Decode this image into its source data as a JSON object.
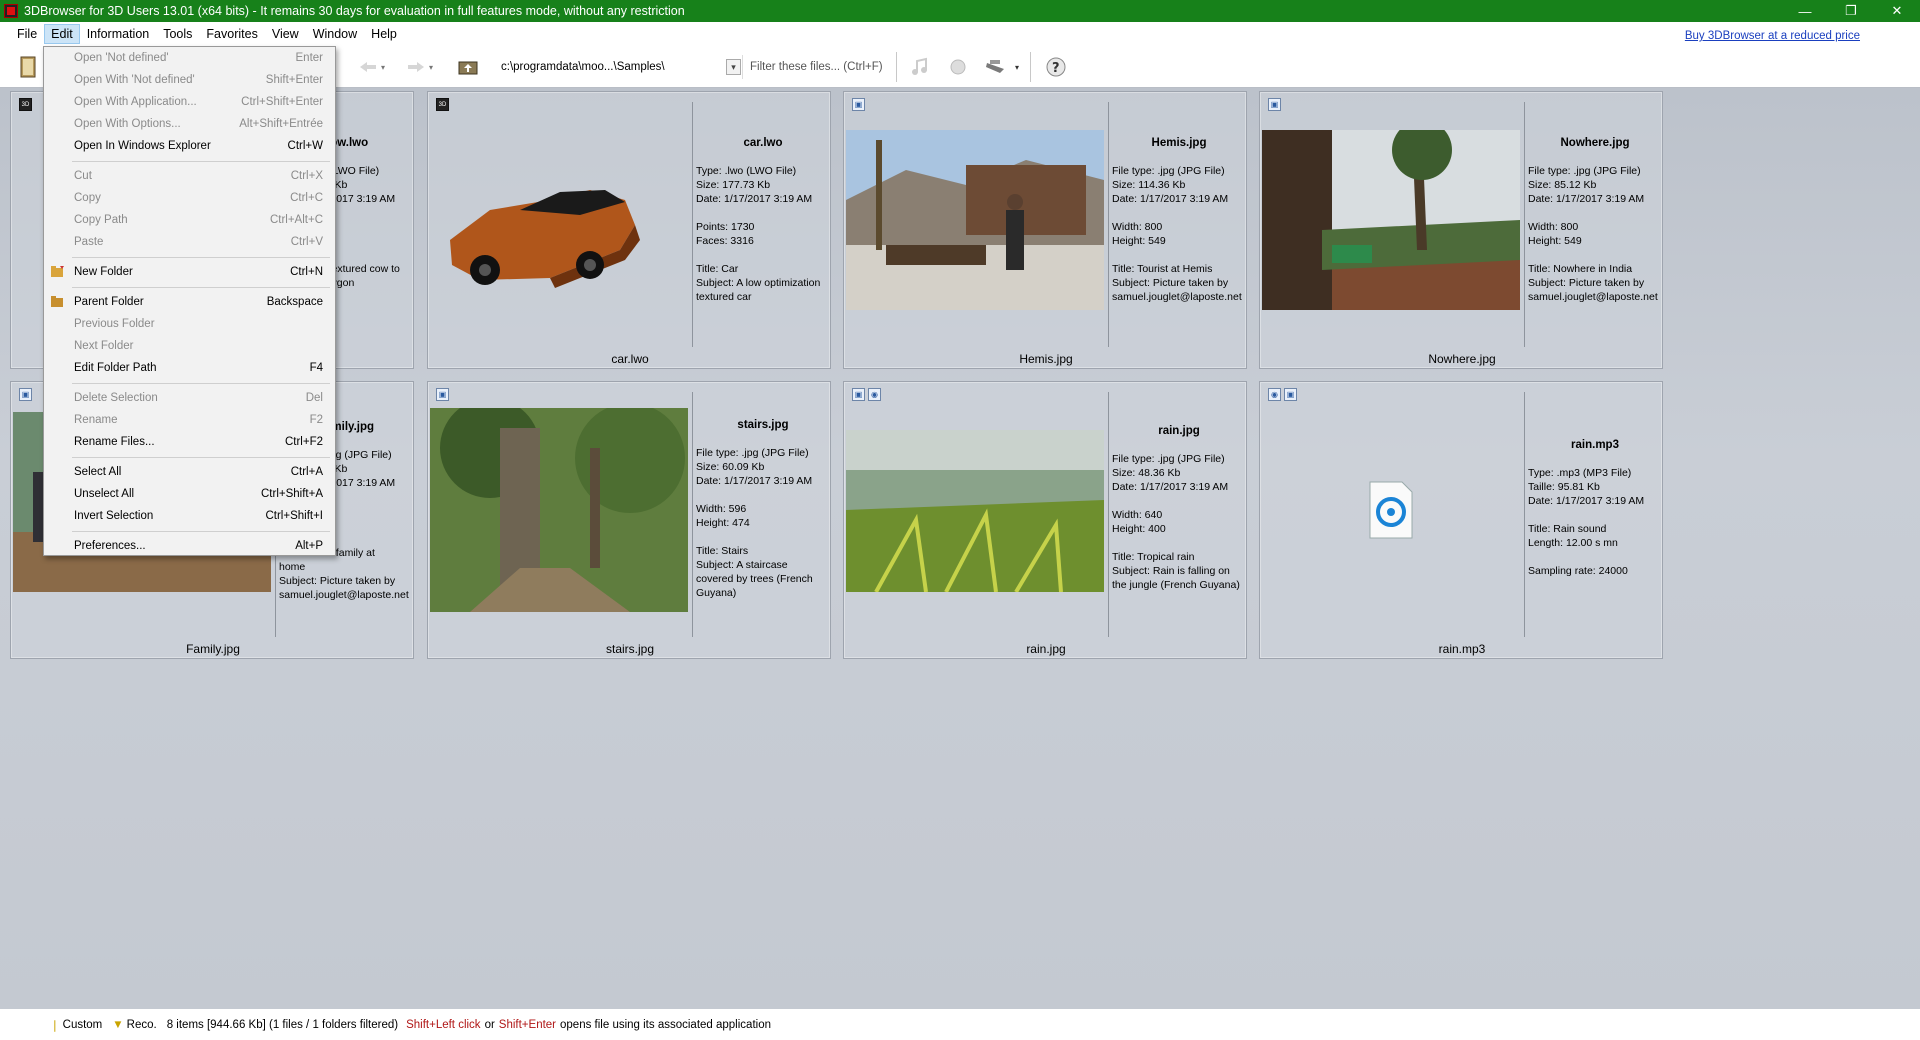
{
  "window": {
    "title": "3DBrowser for 3D Users 13.01 (x64 bits) - It remains 30 days for evaluation in full features mode, without any restriction",
    "buy_link": "Buy 3DBrowser at a reduced price"
  },
  "menubar": [
    "File",
    "Edit",
    "Information",
    "Tools",
    "Favorites",
    "View",
    "Window",
    "Help"
  ],
  "toolbar": {
    "path": "c:\\programdata\\moo...\\Samples\\",
    "filter_placeholder": "Filter these files... (Ctrl+F)"
  },
  "edit_menu": {
    "items": [
      {
        "label": "Open 'Not defined'",
        "shortcut": "Enter"
      },
      {
        "label": "Open With 'Not defined'",
        "shortcut": "Shift+Enter"
      },
      {
        "label": "Open With Application...",
        "shortcut": "Ctrl+Shift+Enter"
      },
      {
        "label": "Open With Options...",
        "shortcut": "Alt+Shift+Entrée"
      },
      {
        "label": "Open In Windows Explorer",
        "shortcut": "Ctrl+W"
      },
      {
        "label": "Cut",
        "shortcut": "Ctrl+X"
      },
      {
        "label": "Copy",
        "shortcut": "Ctrl+C"
      },
      {
        "label": "Copy Path",
        "shortcut": "Ctrl+Alt+C"
      },
      {
        "label": "Paste",
        "shortcut": "Ctrl+V"
      },
      {
        "label": "New Folder",
        "shortcut": "Ctrl+N"
      },
      {
        "label": "Parent Folder",
        "shortcut": "Backspace"
      },
      {
        "label": "Previous Folder",
        "shortcut": ""
      },
      {
        "label": "Next Folder",
        "shortcut": ""
      },
      {
        "label": "Edit Folder Path",
        "shortcut": "F4"
      },
      {
        "label": "Delete Selection",
        "shortcut": "Del"
      },
      {
        "label": "Rename",
        "shortcut": "F2"
      },
      {
        "label": "Rename Files...",
        "shortcut": "Ctrl+F2"
      },
      {
        "label": "Select All",
        "shortcut": "Ctrl+A"
      },
      {
        "label": "Unselect All",
        "shortcut": "Ctrl+Shift+A"
      },
      {
        "label": "Invert Selection",
        "shortcut": "Ctrl+Shift+I"
      },
      {
        "label": "Preferences...",
        "shortcut": "Alt+P"
      }
    ]
  },
  "cards": [
    {
      "filename": "cow.lwo",
      "title": "cow.lwo",
      "lines": [
        "Type: .lwo (LWO File)",
        "Size: 24.12 Kb",
        "Date: 1/17/2017 3:19 AM",
        "",
        "Subject: A textured cow to",
        "test the Polygon"
      ]
    },
    {
      "filename": "car.lwo",
      "title": "car.lwo",
      "lines": [
        "Type: .lwo (LWO File)",
        "Size: 177.73 Kb",
        "Date: 1/17/2017 3:19 AM",
        "",
        "Points: 1730",
        "Faces: 3316",
        "",
        "Title: Car",
        "Subject: A low optimization",
        "textured car"
      ]
    },
    {
      "filename": "Hemis.jpg",
      "title": "Hemis.jpg",
      "lines": [
        "File type: .jpg (JPG File)",
        "Size: 114.36 Kb",
        "Date: 1/17/2017 3:19 AM",
        "",
        "Width: 800",
        "Height: 549",
        "",
        "Title: Tourist at Hemis",
        "Subject: Picture taken by",
        "samuel.jouglet@laposte.net"
      ]
    },
    {
      "filename": "Nowhere.jpg",
      "title": "Nowhere.jpg",
      "lines": [
        "File type: .jpg (JPG File)",
        "Size: 85.12 Kb",
        "Date: 1/17/2017 3:19 AM",
        "",
        "Width: 800",
        "Height: 549",
        "",
        "Title: Nowhere in India",
        "Subject: Picture taken by",
        "samuel.jouglet@laposte.net"
      ]
    },
    {
      "filename": "Family.jpg",
      "title": "Family.jpg",
      "lines": [
        "File type: .jpg (JPG File)",
        "Size: 95.47 Kb",
        "Date: 1/17/2017 3:19 AM",
        "",
        "",
        "",
        "",
        "Title: Indian family at",
        "home",
        "Subject: Picture taken by",
        "samuel.jouglet@laposte.net"
      ]
    },
    {
      "filename": "stairs.jpg",
      "title": "stairs.jpg",
      "lines": [
        "File type: .jpg (JPG File)",
        "Size: 60.09 Kb",
        "Date: 1/17/2017 3:19 AM",
        "",
        "Width: 596",
        "Height: 474",
        "",
        "Title: Stairs",
        "Subject: A staircase",
        "covered by trees (French",
        "Guyana)"
      ]
    },
    {
      "filename": "rain.jpg",
      "title": "rain.jpg",
      "lines": [
        "File type: .jpg (JPG File)",
        "Size: 48.36 Kb",
        "Date: 1/17/2017 3:19 AM",
        "",
        "Width: 640",
        "Height: 400",
        "",
        "Title: Tropical rain",
        "Subject: Rain is falling on",
        "the jungle (French Guyana)"
      ]
    },
    {
      "filename": "rain.mp3",
      "title": "rain.mp3",
      "lines": [
        "Type: .mp3 (MP3 File)",
        "Taille: 95.81 Kb",
        "Date: 1/17/2017 3:19 AM",
        "",
        "Title: Rain sound",
        "Length: 12.00 s mn",
        "",
        "Sampling rate: 24000"
      ]
    }
  ],
  "statusbar": {
    "custom": "Custom",
    "reco": "Reco.",
    "summary": "8 items [944.66 Kb] (1 files / 1 folders filtered)",
    "hint1": "Shift+Left click",
    "or": "or",
    "hint2": "Shift+Enter",
    "hint_end": "opens file using its associated application"
  }
}
